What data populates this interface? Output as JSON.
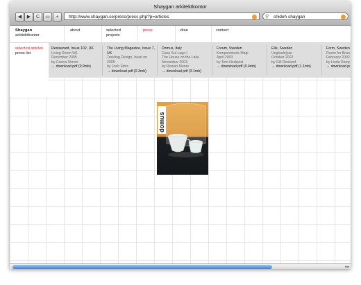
{
  "window": {
    "title": "Shaygan arkitektkontor",
    "url": "http://www.shaygan.se/press/press.php?p=articles",
    "search": "shideh shaygan",
    "toolbar": {
      "back": "◀",
      "forward": "▶",
      "reload": "C",
      "bookmark": "▭",
      "add": "+"
    }
  },
  "brand": {
    "name": "Shaygan",
    "sub": "arkitektkontor"
  },
  "nav": [
    {
      "label": "about",
      "active": false
    },
    {
      "label": "selected projects",
      "active": false
    },
    {
      "label": "press",
      "active": true
    },
    {
      "label": "vitae",
      "active": false
    },
    {
      "label": "contact",
      "active": false
    }
  ],
  "side": {
    "articles": "selected articles",
    "list": "press list"
  },
  "articles": [
    {
      "title": "Restaurant, Issue 102, UK",
      "lines": [
        "Living Room W1",
        "December 2005",
        "by Carina Simon"
      ],
      "download": "→ download pdf (0.9mb)"
    },
    {
      "title": "The Living Magazine, Issue 7, UK",
      "lines": [
        "Tackling Design, head on",
        "2005",
        "by Josh Sims"
      ],
      "download": "→ download pdf (0.3mb)"
    },
    {
      "title": "Domus, Italy",
      "lines": [
        "Casa Sul Lago /",
        "The House on the Lake",
        "November 2003",
        "by Rowan Moore"
      ],
      "download": "→ download pdf (3.1mb)"
    },
    {
      "title": "Forum, Sweden",
      "lines": [
        "Komponisteds Magi",
        "April 2003",
        "by Tom Hedqvist"
      ],
      "download": "→ download pdf (0.4mb)"
    },
    {
      "title": "Elle, Sweden",
      "lines": [
        "Ungkarlslyan",
        "October 2002",
        "by Gill Renlund"
      ],
      "download": "→ download pdf (1.1mb)"
    },
    {
      "title": "Form, Sweden",
      "lines": [
        "Room for Brandt",
        "February 2002",
        "by Linda Rampell"
      ],
      "download": "→ download pdf"
    }
  ],
  "magazine": {
    "logo": "domus"
  },
  "scrollbar": {
    "arrows": "◂ ▸"
  }
}
